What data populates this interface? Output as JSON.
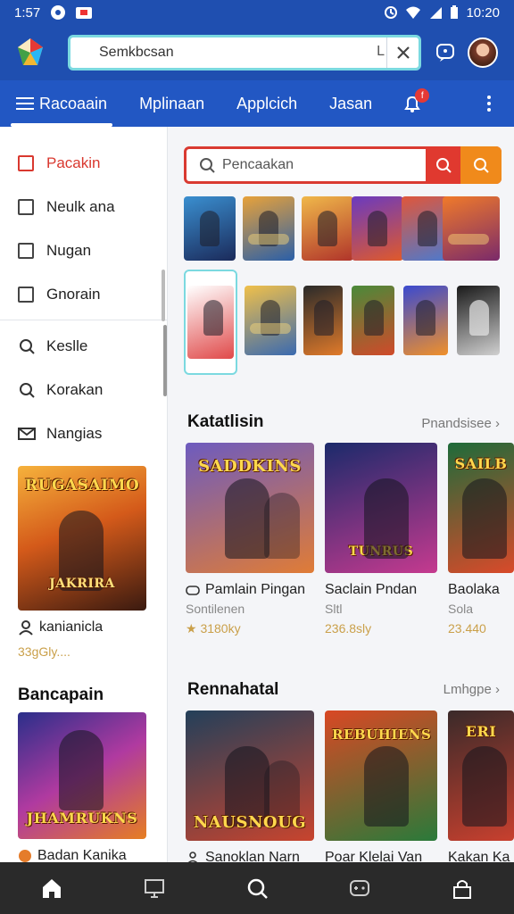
{
  "status": {
    "time_left": "1:57",
    "time_right": "10:20"
  },
  "search": {
    "value": "Semkbcsan",
    "q_glyph": "L"
  },
  "tabs": [
    {
      "label": "Racoaain",
      "active": true
    },
    {
      "label": "Mplinaan",
      "active": false
    },
    {
      "label": "Applcich",
      "active": false
    },
    {
      "label": "Jasan",
      "active": false
    }
  ],
  "notification_count": "f",
  "sidebar": {
    "checks": [
      {
        "label": "Pacakin",
        "active": true
      },
      {
        "label": "Neulk ana",
        "active": false
      },
      {
        "label": "Nugan",
        "active": false
      },
      {
        "label": "Gnorain",
        "active": false
      }
    ],
    "links": [
      {
        "label": "Keslle",
        "icon": "search-icon"
      },
      {
        "label": "Korakan",
        "icon": "search-icon"
      },
      {
        "label": "Nangias",
        "icon": "mail-icon"
      }
    ],
    "featured": {
      "cover_text": "RUGASAIMO",
      "cover_sub": "JAKRIRA",
      "title": "kanianicla",
      "price": "33gGly...."
    },
    "heading": "Bancapain",
    "featured2": {
      "cover_text": "JHAMRUKNS",
      "title": "Badan Kanika"
    }
  },
  "main": {
    "search_placeholder": "Pencaakan",
    "section1": {
      "title": "Katatlisin",
      "more": "Pnandsisee",
      "cards": [
        {
          "cover_text": "SADDKINS",
          "title": "Pamlain Pingan",
          "sub": "Sontilenen",
          "price": "3180ky",
          "color_a": "#6d5bbf",
          "color_b": "#e07c36"
        },
        {
          "cover_text": "TUNRUS",
          "title": "Saclain Pndan",
          "sub": "Sltl",
          "price": "236.8sly",
          "color_a": "#1b2a6b",
          "color_b": "#c53a8f"
        },
        {
          "cover_text": "SAILB",
          "title": "Baolaka",
          "sub": "Sola",
          "price": "23.440",
          "color_a": "#1e6b3a",
          "color_b": "#d94a2a"
        }
      ]
    },
    "section2": {
      "title": "Rennahatal",
      "more": "Lmhgpe",
      "cards": [
        {
          "cover_text": "NAUSNOUG",
          "title": "Sanoklan Narn",
          "color_a": "#23405a",
          "color_b": "#c8442e"
        },
        {
          "cover_text": "REBUHIENS",
          "title": "Poar Klelai Van",
          "color_a": "#d94824",
          "color_b": "#2a7a3a"
        },
        {
          "cover_text": "ERI",
          "title": "Kakan Ka",
          "color_a": "#3a2a2a",
          "color_b": "#c8402e"
        }
      ]
    }
  },
  "colors": {
    "primary": "#1f4fb0",
    "tabbar": "#2257c3",
    "accent_red": "#d9382f",
    "accent_orange": "#f08a1b",
    "focus_ring": "#7bd9e0"
  }
}
